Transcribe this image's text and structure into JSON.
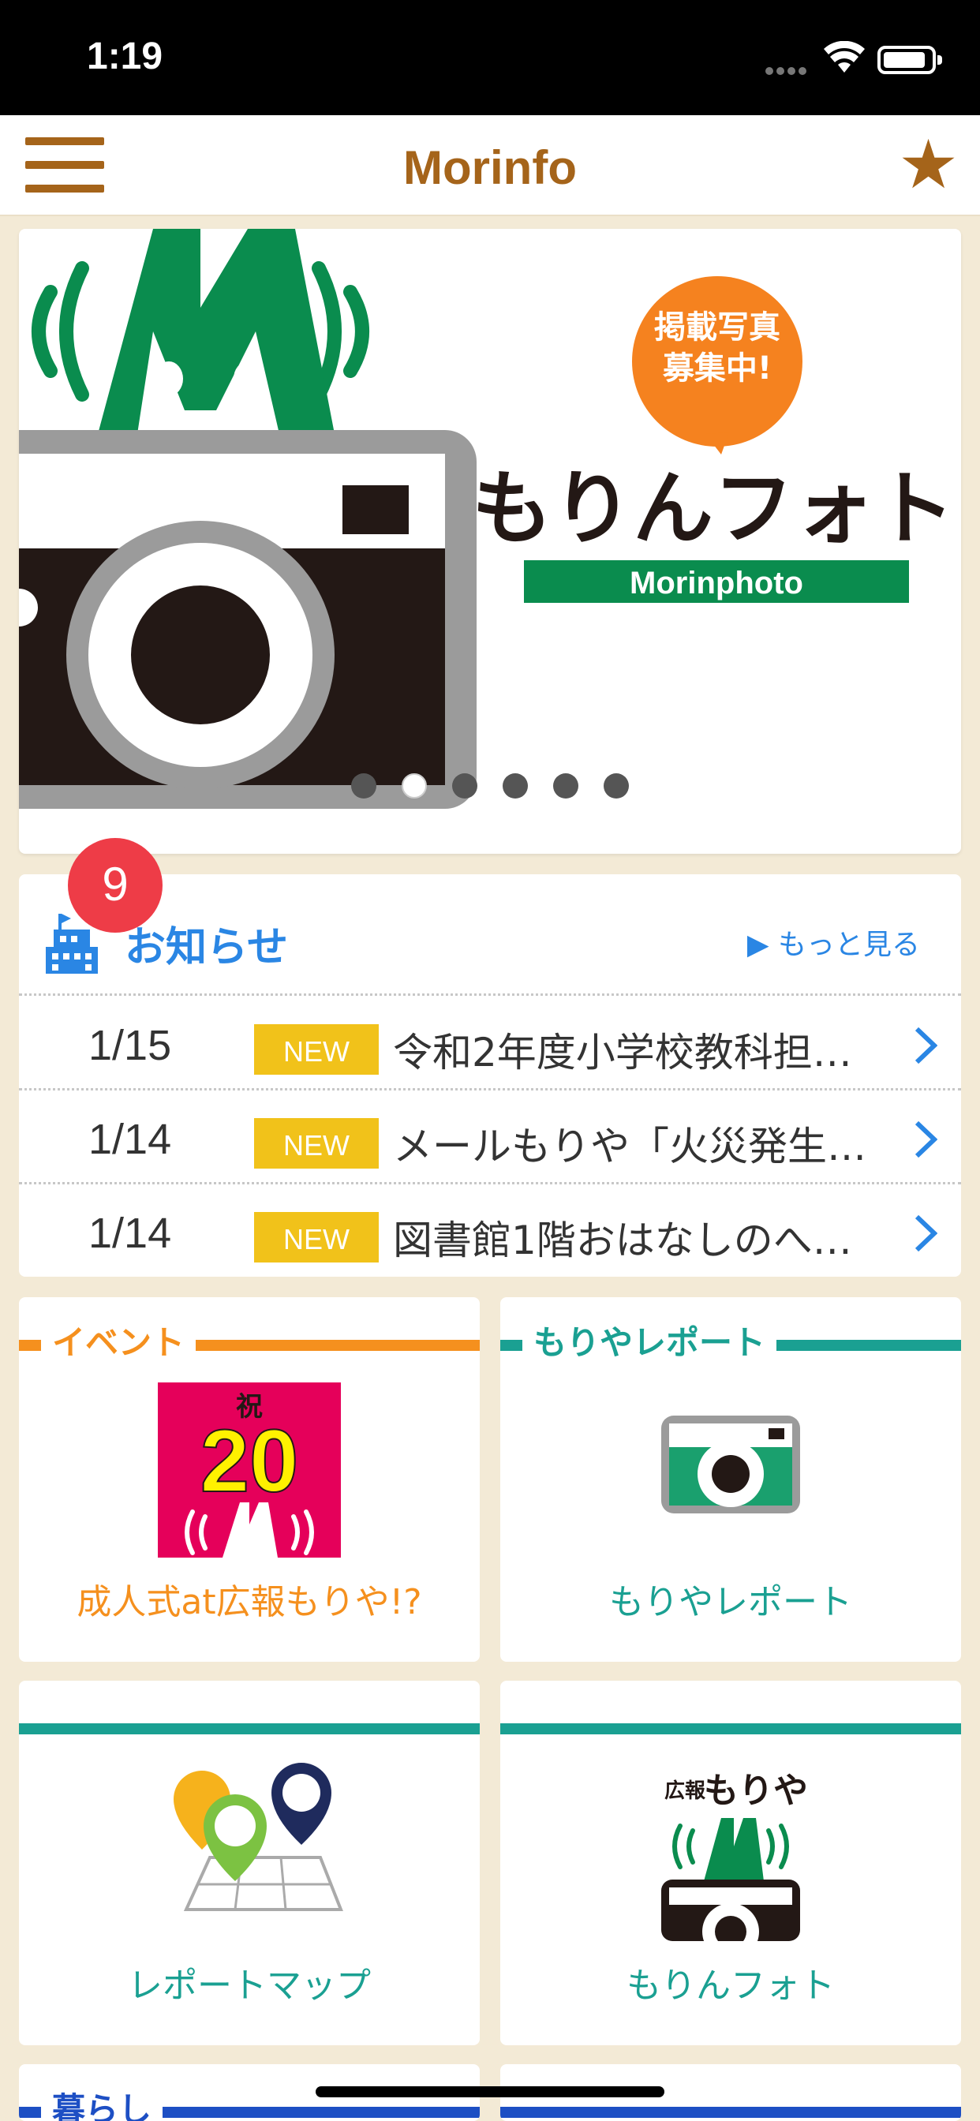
{
  "status_bar": {
    "time": "1:19"
  },
  "nav": {
    "title": "Morinfo"
  },
  "banner": {
    "bubble_line1": "掲載写真",
    "bubble_line2": "募集中!",
    "title": "もりんフォト",
    "subtitle": "Morinphoto",
    "active_dot": 1,
    "dot_count": 6
  },
  "notices": {
    "label": "お知らせ",
    "badge": "9",
    "more": "もっと見る",
    "items": [
      {
        "date": "1/15",
        "tag": "NEW",
        "text": "令和2年度小学校教科担…"
      },
      {
        "date": "1/14",
        "tag": "NEW",
        "text": "メールもりや「火災発生…"
      },
      {
        "date": "1/14",
        "tag": "NEW",
        "text": "図書館1階おはなしのへ…"
      }
    ]
  },
  "tiles": {
    "event": {
      "header": "イベント",
      "caption": "成人式at広報もりや!?",
      "icon_badge_top": "祝",
      "icon_badge_num": "20"
    },
    "report": {
      "header": "もりやレポート",
      "caption": "もりやレポート"
    },
    "map": {
      "caption": "レポートマップ"
    },
    "photo": {
      "caption": "もりんフォト",
      "icon_label1": "広報",
      "icon_label2": "もりや"
    },
    "life": {
      "header": "暮らし"
    }
  },
  "colors": {
    "brand": "#a5641a",
    "event": "#f5901e",
    "report": "#1aa092",
    "info_blue": "#2a86e4",
    "new_badge": "#f1c21a",
    "alert": "#ee3c47",
    "green": "#0a8c4e"
  }
}
